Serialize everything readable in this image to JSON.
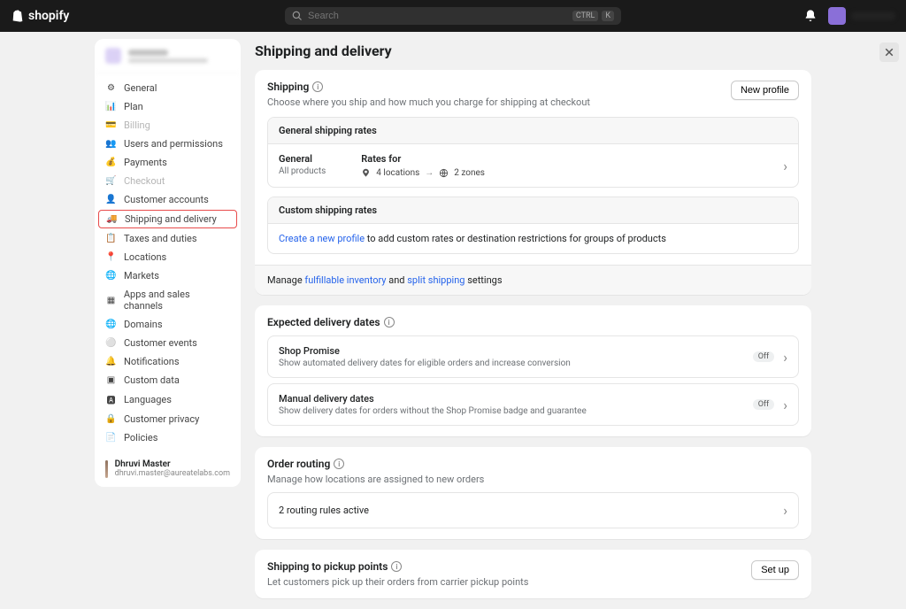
{
  "topbar": {
    "brand": "shopify",
    "search_placeholder": "Search",
    "key_hint_1": "CTRL",
    "key_hint_2": "K"
  },
  "sidebar": {
    "items": [
      {
        "label": "General",
        "muted": false,
        "active": false
      },
      {
        "label": "Plan",
        "muted": false,
        "active": false
      },
      {
        "label": "Billing",
        "muted": true,
        "active": false
      },
      {
        "label": "Users and permissions",
        "muted": false,
        "active": false
      },
      {
        "label": "Payments",
        "muted": false,
        "active": false
      },
      {
        "label": "Checkout",
        "muted": true,
        "active": false
      },
      {
        "label": "Customer accounts",
        "muted": false,
        "active": false
      },
      {
        "label": "Shipping and delivery",
        "muted": false,
        "active": true
      },
      {
        "label": "Taxes and duties",
        "muted": false,
        "active": false
      },
      {
        "label": "Locations",
        "muted": false,
        "active": false
      },
      {
        "label": "Markets",
        "muted": false,
        "active": false
      },
      {
        "label": "Apps and sales channels",
        "muted": false,
        "active": false
      },
      {
        "label": "Domains",
        "muted": false,
        "active": false
      },
      {
        "label": "Customer events",
        "muted": false,
        "active": false
      },
      {
        "label": "Notifications",
        "muted": false,
        "active": false
      },
      {
        "label": "Custom data",
        "muted": false,
        "active": false
      },
      {
        "label": "Languages",
        "muted": false,
        "active": false
      },
      {
        "label": "Customer privacy",
        "muted": false,
        "active": false
      },
      {
        "label": "Policies",
        "muted": false,
        "active": false
      }
    ],
    "user_name": "Dhruvi Master",
    "user_email": "dhruvi.master@aureatelabs.com"
  },
  "page": {
    "title": "Shipping and delivery"
  },
  "shipping": {
    "title": "Shipping",
    "subtitle": "Choose where you ship and how much you charge for shipping at checkout",
    "new_profile_btn": "New profile",
    "general_rates_heading": "General shipping rates",
    "general_profile_name": "General",
    "general_profile_sub": "All products",
    "rates_for_label": "Rates for",
    "locations_count": "4 locations",
    "zones_count": "2 zones",
    "custom_rates_heading": "Custom shipping rates",
    "create_profile_link": "Create a new profile",
    "create_profile_rest": " to add custom rates or destination restrictions for groups of products",
    "manage_prefix": "Manage ",
    "fulfillable_link": "fulfillable inventory",
    "and": " and ",
    "split_link": "split shipping",
    "settings_suffix": " settings"
  },
  "expected": {
    "title": "Expected delivery dates",
    "shop_promise_title": "Shop Promise",
    "shop_promise_sub": "Show automated delivery dates for eligible orders and increase conversion",
    "shop_promise_badge": "Off",
    "manual_title": "Manual delivery dates",
    "manual_sub": "Show delivery dates for orders without the Shop Promise badge and guarantee",
    "manual_badge": "Off"
  },
  "routing": {
    "title": "Order routing",
    "subtitle": "Manage how locations are assigned to new orders",
    "rules_active": "2 routing rules active"
  },
  "pickup": {
    "title": "Shipping to pickup points",
    "subtitle": "Let customers pick up their orders from carrier pickup points",
    "setup_btn": "Set up"
  }
}
